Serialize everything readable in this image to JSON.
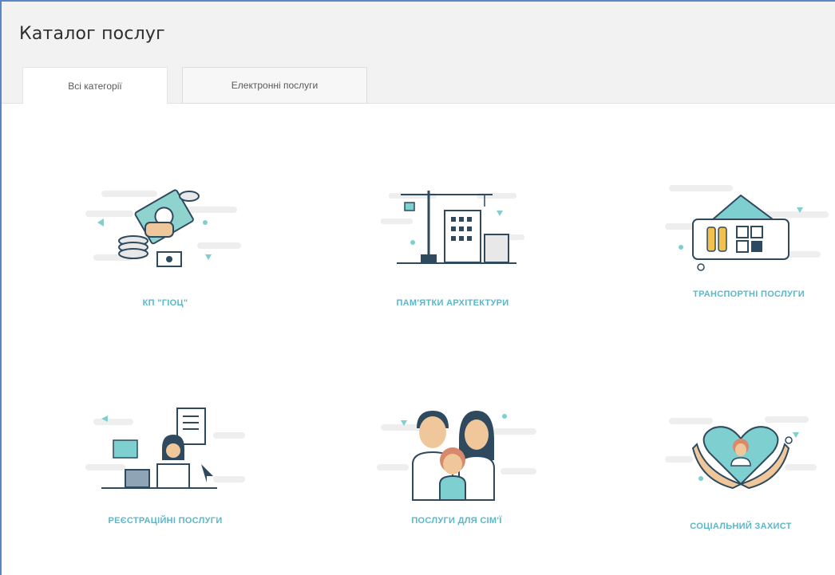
{
  "page": {
    "title": "Каталог послуг"
  },
  "tabs": [
    {
      "label": "Всі категорії",
      "active": true
    },
    {
      "label": "Електронні послуги",
      "active": false
    }
  ],
  "categories": [
    {
      "label": "КП \"ГІОЦ\"",
      "icon": "money-hand-icon"
    },
    {
      "label": "ПАМ'ЯТКИ АРХІТЕКТУРИ",
      "icon": "construction-crane-icon"
    },
    {
      "label": "ТРАНСПОРТНІ ПОСЛУГИ",
      "icon": "transport-ticket-icon"
    },
    {
      "label": "РЕЄСТРАЦІЙНІ ПОСЛУГИ",
      "icon": "registration-clerk-icon"
    },
    {
      "label": "ПОСЛУГИ ДЛЯ СІМ'Ї",
      "icon": "family-icon"
    },
    {
      "label": "СОЦІАЛЬНИЙ ЗАХИСТ",
      "icon": "heart-hands-icon"
    }
  ],
  "colors": {
    "accent": "#5bb8c8",
    "border": "#5b86c4",
    "teal": "#7ecfd0",
    "navy": "#2f4a5e",
    "yellow": "#f2c14e"
  }
}
